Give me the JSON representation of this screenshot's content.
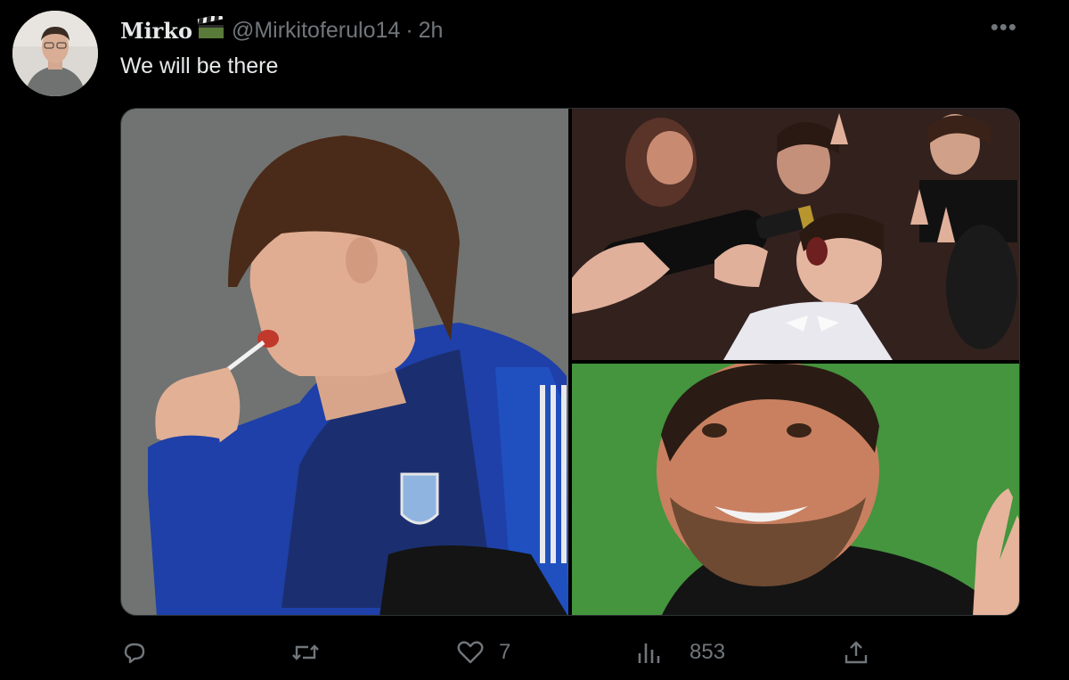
{
  "tweet": {
    "author_name": "Mirko",
    "author_emoji_icon": "clapperboard-icon",
    "handle": "@Mirkitoferulo14",
    "separator": "·",
    "time": "2h",
    "text": "We will be there",
    "more_label": "•••"
  },
  "media": {
    "images": [
      {
        "name": "image-left",
        "description_icon": "photo"
      },
      {
        "name": "image-top-right",
        "description_icon": "photo"
      },
      {
        "name": "image-bottom-right",
        "description_icon": "photo"
      }
    ]
  },
  "actions": {
    "reply_count": "",
    "retweet_count": "",
    "like_count": "7",
    "views_count": "853"
  },
  "colors": {
    "background": "#000000",
    "text_primary": "#e7e9ea",
    "text_secondary": "#71767b",
    "border": "#2f3336"
  }
}
